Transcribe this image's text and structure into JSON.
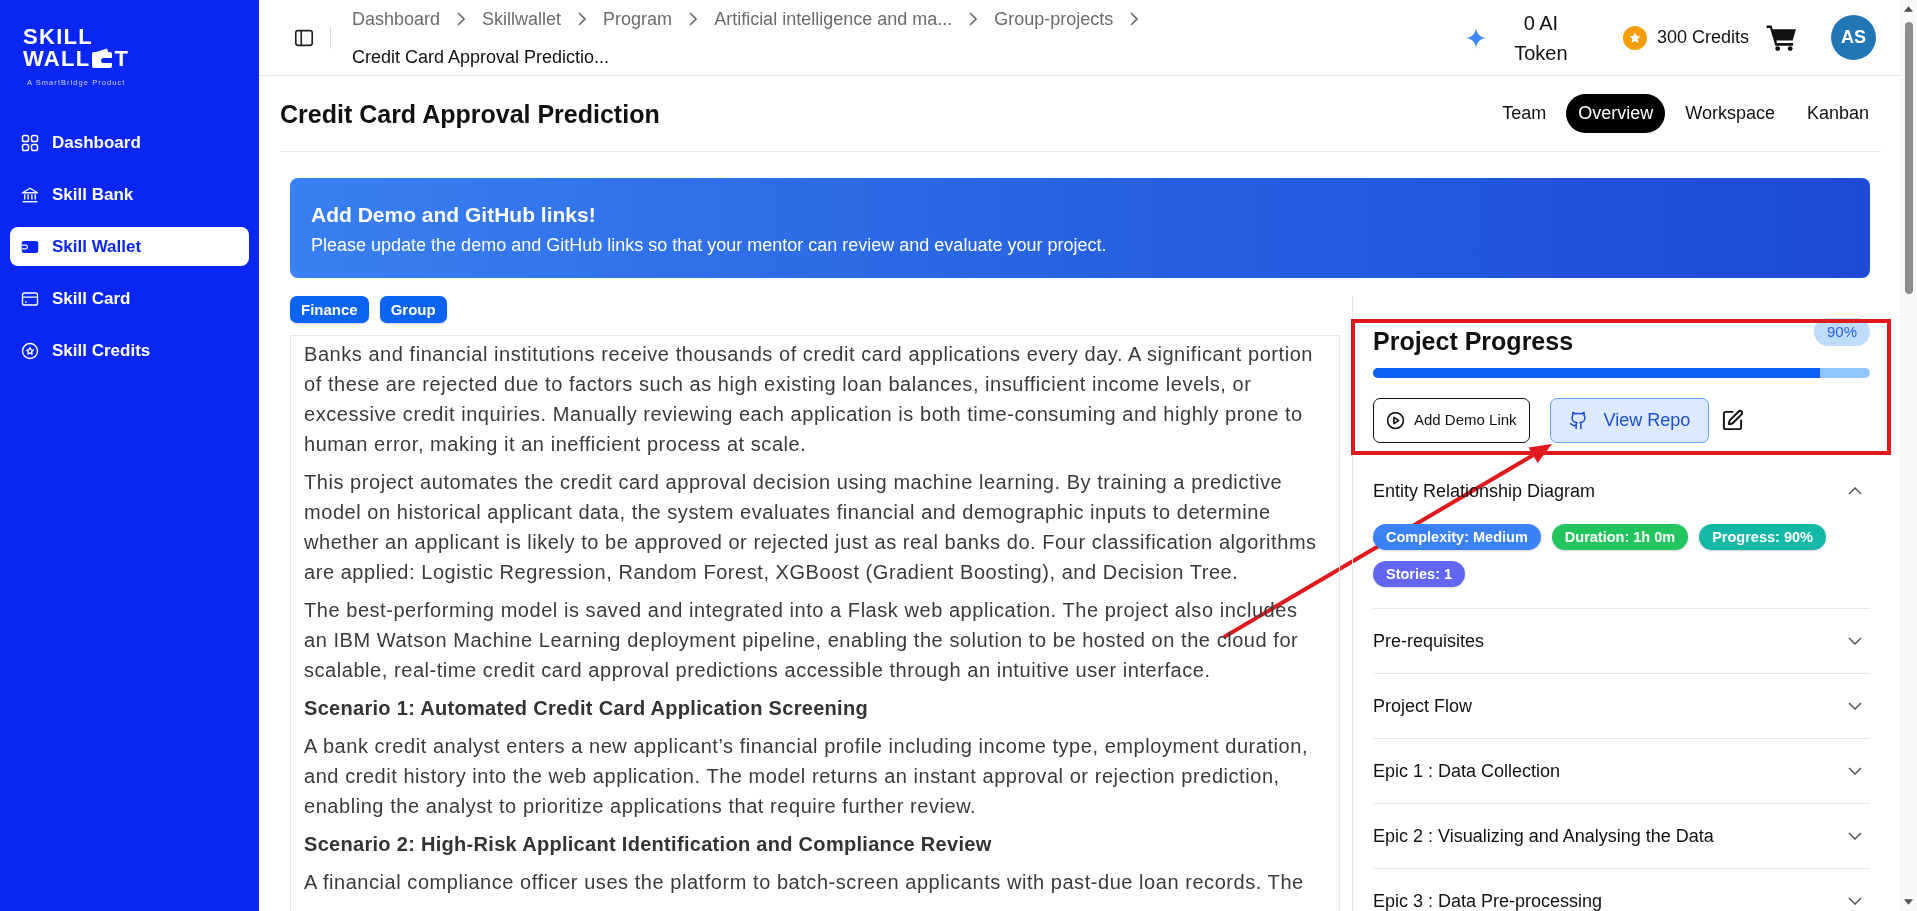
{
  "sidebar": {
    "logo": {
      "line_1": "SKILL",
      "line_2_start": "WALL",
      "line_2_end": "T",
      "tagline": "A SmartBridge Product"
    },
    "items": [
      {
        "label": "Dashboard",
        "selected": false
      },
      {
        "label": "Skill Bank",
        "selected": false
      },
      {
        "label": "Skill Wallet",
        "selected": true
      },
      {
        "label": "Skill Card",
        "selected": false
      },
      {
        "label": "Skill Credits",
        "selected": false
      }
    ]
  },
  "header": {
    "breadcrumb": [
      {
        "label": "Dashboard",
        "current": false
      },
      {
        "label": "Skillwallet",
        "current": false
      },
      {
        "label": "Program",
        "current": false
      },
      {
        "label": "Artificial intelligence and ma...",
        "current": false
      },
      {
        "label": "Group-projects",
        "current": false
      },
      {
        "label": "Credit Card Approval Predictio...",
        "current": true
      }
    ],
    "ai_tokens": "0 AI Token",
    "credits": "300 Credits",
    "avatar": "AS"
  },
  "page": {
    "title": "Credit Card Approval Prediction",
    "tabs": [
      {
        "label": "Team",
        "selected": false
      },
      {
        "label": "Overview",
        "selected": true
      },
      {
        "label": "Workspace",
        "selected": false
      },
      {
        "label": "Kanban",
        "selected": false
      }
    ]
  },
  "banner": {
    "title": "Add Demo and GitHub links!",
    "text": "Please update the demo and GitHub links so that your mentor can review and evaluate your project."
  },
  "tags": [
    "Finance",
    "Group"
  ],
  "description": [
    {
      "kind": "paragraph",
      "text": "Banks and financial institutions receive thousands of credit card applications every day. A significant portion of these are rejected due to factors such as high existing loan balances, insufficient income levels, or excessive credit inquiries. Manually reviewing each application is both time-consuming and highly prone to human error, making it an inefficient process at scale."
    },
    {
      "kind": "paragraph",
      "text": "This project automates the credit card approval decision using machine learning. By training a predictive model on historical applicant data, the system evaluates financial and demographic inputs to determine whether an applicant is likely to be approved or rejected just as real banks do. Four classification algorithms are applied: Logistic Regression, Random Forest, XGBoost (Gradient Boosting), and Decision Tree."
    },
    {
      "kind": "paragraph",
      "text": "The best-performing model is saved and integrated into a Flask web application. The project also includes an IBM Watson Machine Learning deployment pipeline, enabling the solution to be hosted on the cloud for scalable, real-time credit card approval predictions accessible through an intuitive user interface."
    },
    {
      "kind": "heading",
      "text": "Scenario 1: Automated Credit Card Application Screening"
    },
    {
      "kind": "paragraph",
      "text": "A bank credit analyst enters a new applicant’s financial profile including income type, employment duration, and credit history into the web application. The model returns an instant approval or rejection prediction, enabling the analyst to prioritize applications that require further review."
    },
    {
      "kind": "heading",
      "text": "Scenario 2: High-Risk Applicant Identification and Compliance Review"
    },
    {
      "kind": "paragraph",
      "text": "A financial compliance officer uses the platform to batch-screen applicants with past-due loan records. The"
    }
  ],
  "progress": {
    "title": "Project Progress",
    "badge": "90%",
    "level": 0.9,
    "buttons": [
      {
        "kind": "outline",
        "label": "Add Demo Link"
      },
      {
        "kind": "soft",
        "label": "View Repo"
      }
    ]
  },
  "sections": [
    {
      "title": "Entity Relationship Diagram",
      "expanded": true,
      "badges": [
        {
          "text": "Complexity: Medium",
          "color": "#3b82f6"
        },
        {
          "text": "Duration: 1h 0m",
          "color": "#22c55e"
        },
        {
          "text": "Progress: 90%",
          "color": "#14b8a6"
        },
        {
          "text": "Stories: 1",
          "color": "#6366f1"
        }
      ]
    },
    {
      "title": "Pre-requisites",
      "expanded": false
    },
    {
      "title": "Project Flow",
      "expanded": false
    },
    {
      "title": "Epic 1 : Data Collection",
      "expanded": false
    },
    {
      "title": "Epic 2 : Visualizing and Analysing the Data",
      "expanded": false
    },
    {
      "title": "Epic 3 : Data Pre-processing",
      "expanded": false
    }
  ],
  "annotations": [
    {
      "kind": "box"
    },
    {
      "kind": "arrow"
    }
  ]
}
